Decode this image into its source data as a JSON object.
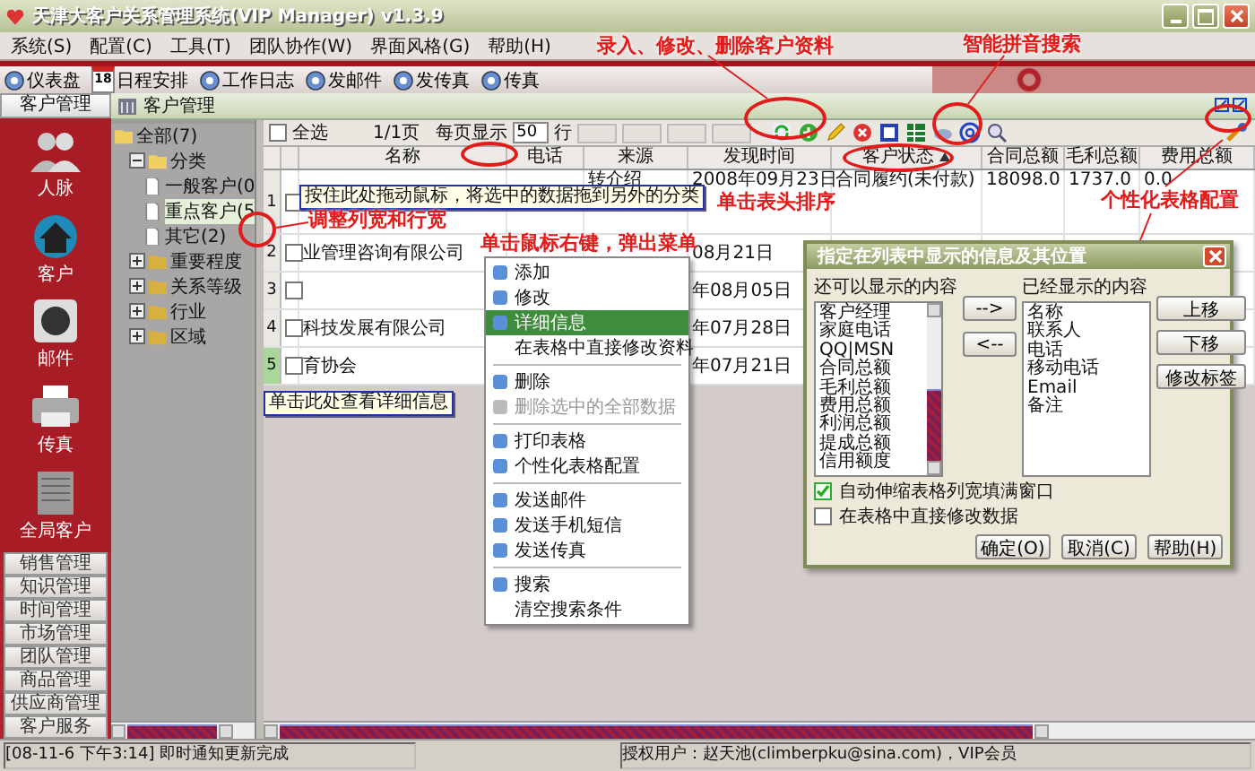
{
  "window": {
    "title": "天津大客户关系管理系统(VIP Manager) v1.3.9"
  },
  "menu": [
    {
      "label": "系统(S)"
    },
    {
      "label": "配置(C)"
    },
    {
      "label": "工具(T)"
    },
    {
      "label": "团队协作(W)"
    },
    {
      "label": "界面风格(G)"
    },
    {
      "label": "帮助(H)"
    }
  ],
  "toolbar": [
    {
      "label": "仪表盘"
    },
    {
      "label": "日程安排",
      "badge": "18"
    },
    {
      "label": "工作日志"
    },
    {
      "label": "发邮件"
    },
    {
      "label": "发传真"
    },
    {
      "label": "传真"
    }
  ],
  "sidebar": {
    "header": "客户管理",
    "shortcuts": [
      {
        "label": "人脉"
      },
      {
        "label": "客户"
      },
      {
        "label": "邮件"
      },
      {
        "label": "传真"
      },
      {
        "label": "全局客户"
      }
    ],
    "modules": [
      "销售管理",
      "知识管理",
      "时间管理",
      "市场管理",
      "团队管理",
      "商品管理",
      "供应商管理",
      "客户服务"
    ]
  },
  "panel": {
    "title": "客户管理"
  },
  "tree": [
    {
      "label": "全部(7)",
      "expanded": true,
      "children": [
        {
          "label": "分类",
          "expanded": true,
          "children": [
            {
              "label": "一般客户(0",
              "selected": false
            },
            {
              "label": "重点客户(5",
              "selected": true
            },
            {
              "label": "其它(2)",
              "selected": false
            }
          ]
        },
        {
          "label": "重要程度",
          "expanded": false
        },
        {
          "label": "关系等级",
          "expanded": false
        },
        {
          "label": "行业",
          "expanded": false
        },
        {
          "label": "区域",
          "expanded": false
        }
      ]
    }
  ],
  "grid": {
    "select_all": {
      "label": "全选",
      "checked": false
    },
    "page": "1/1页",
    "per_page_label": "每页显示",
    "per_page": "50",
    "per_page_unit": "行",
    "columns": [
      {
        "label": "名称",
        "sorted": false
      },
      {
        "label": "电话",
        "sorted": false
      },
      {
        "label": "来源",
        "sorted": false
      },
      {
        "label": "发现时间",
        "sorted": false
      },
      {
        "label": "客户状态",
        "sorted": true
      },
      {
        "label": "合同总额",
        "sorted": false
      },
      {
        "label": "毛利总额",
        "sorted": false
      },
      {
        "label": "费用总额",
        "sorted": false
      }
    ],
    "rows": [
      {
        "number": "1",
        "checked": false,
        "selected": false,
        "cells": [
          null,
          null,
          "转介绍",
          "2008年09月23日",
          "合同履约(未付款)",
          "18098.0",
          "1737.0",
          "0.0"
        ]
      },
      {
        "number": "2",
        "checked": false,
        "selected": false,
        "cells": [
          "业管理咨询有限公司",
          null,
          null,
          "08月21日",
          null,
          null,
          null,
          null
        ]
      },
      {
        "number": "3",
        "checked": false,
        "selected": false,
        "cells": [
          null,
          null,
          null,
          "年08月05日",
          null,
          null,
          null,
          null
        ]
      },
      {
        "number": "4",
        "checked": false,
        "selected": false,
        "cells": [
          "科技发展有限公司",
          null,
          null,
          "年07月28日",
          null,
          null,
          null,
          null
        ]
      },
      {
        "number": "5",
        "checked": false,
        "selected": true,
        "cells": [
          "育协会",
          null,
          null,
          "年07月21日",
          null,
          null,
          null,
          null
        ]
      }
    ]
  },
  "context_menu": {
    "items": [
      {
        "label": "添加",
        "icon": true,
        "selected": false,
        "disabled": false,
        "separator_before": false
      },
      {
        "label": "修改",
        "icon": true,
        "selected": false,
        "disabled": false,
        "separator_before": false
      },
      {
        "label": "详细信息",
        "icon": true,
        "selected": true,
        "disabled": false,
        "separator_before": false
      },
      {
        "label": "在表格中直接修改资料",
        "icon": false,
        "selected": false,
        "disabled": false,
        "separator_before": false
      },
      {
        "label": "删除",
        "icon": true,
        "selected": false,
        "disabled": false,
        "separator_before": true
      },
      {
        "label": "删除选中的全部数据",
        "icon": true,
        "selected": false,
        "disabled": true,
        "separator_before": false
      },
      {
        "label": "打印表格",
        "icon": true,
        "selected": false,
        "disabled": false,
        "separator_before": true
      },
      {
        "label": "个性化表格配置",
        "icon": true,
        "selected": false,
        "disabled": false,
        "separator_before": false
      },
      {
        "label": "发送邮件",
        "icon": true,
        "selected": false,
        "disabled": false,
        "separator_before": true
      },
      {
        "label": "发送手机短信",
        "icon": true,
        "selected": false,
        "disabled": false,
        "separator_before": false
      },
      {
        "label": "发送传真",
        "icon": true,
        "selected": false,
        "disabled": false,
        "separator_before": false
      },
      {
        "label": "搜索",
        "icon": true,
        "selected": false,
        "disabled": false,
        "separator_before": true
      },
      {
        "label": "清空搜索条件",
        "icon": false,
        "selected": false,
        "disabled": false,
        "separator_before": false
      }
    ]
  },
  "dialog": {
    "title": "指定在列表中显示的信息及其位置",
    "available_label": "还可以显示的内容",
    "available": [
      "客户经理",
      "家庭电话",
      "QQ|MSN",
      "合同总额",
      "毛利总额",
      "费用总额",
      "利润总额",
      "提成总额",
      "信用额度"
    ],
    "move_buttons": [
      "-->",
      "<--"
    ],
    "shown_label": "已经显示的内容",
    "shown": [
      "名称",
      "联系人",
      "电话",
      "移动电话",
      "Email",
      "备注"
    ],
    "side_buttons": [
      "上移",
      "下移",
      "修改标签"
    ],
    "options": [
      {
        "label": "自动伸缩表格列宽填满窗口",
        "checked": true
      },
      {
        "label": "在表格中直接修改数据",
        "checked": false
      }
    ],
    "buttons": [
      "确定(O)",
      "取消(C)",
      "帮助(H)"
    ]
  },
  "annotations": [
    {
      "text": "录入、修改、删除客户资料"
    },
    {
      "text": "智能拼音搜索"
    },
    {
      "text": "单击表头排序"
    },
    {
      "text": "个性化表格配置"
    },
    {
      "text": "调整列宽和行宽"
    },
    {
      "text": "单击鼠标右键，弹出菜单"
    }
  ],
  "tooltips": [
    {
      "text": "按住此处拖动鼠标，将选中的数据拖到另外的分类"
    },
    {
      "text": "单击此处查看详细信息"
    }
  ],
  "status_bar": {
    "message": "[08-11-6 下午3:14] 即时通知更新完成",
    "user": "授权用户：赵天池(climberpku@sina.com)，VIP会员"
  }
}
